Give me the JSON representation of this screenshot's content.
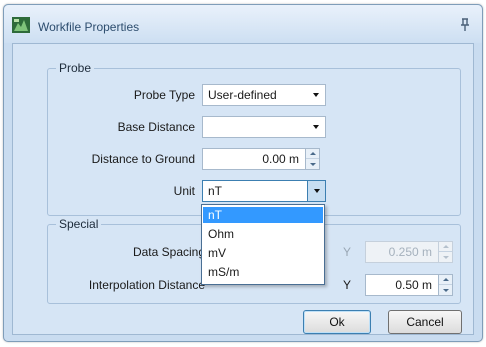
{
  "window": {
    "title": "Workfile Properties",
    "app_icon": "workfile-app-icon",
    "pin_icon": "pin-icon"
  },
  "probe": {
    "group_label": "Probe",
    "probe_type": {
      "label": "Probe Type",
      "value": "User-defined"
    },
    "base_distance": {
      "label": "Base Distance",
      "value": ""
    },
    "distance_to_ground": {
      "label": "Distance to Ground",
      "value": "0.00 m"
    },
    "unit": {
      "label": "Unit",
      "value": "nT"
    }
  },
  "unit_dropdown": {
    "options": [
      "nT",
      "Ohm",
      "mV",
      "mS/m"
    ],
    "selected_index": 0
  },
  "special": {
    "group_label": "Special",
    "data_spacing": {
      "label": "Data Spacing",
      "y_label": "Y",
      "y_value": "0.250 m"
    },
    "interpolation_distance": {
      "label": "Interpolation Distance",
      "y_label": "Y",
      "y_value": "0.50 m"
    }
  },
  "buttons": {
    "ok": "Ok",
    "cancel": "Cancel"
  },
  "colors": {
    "dialog_background": "#d6e5f5",
    "selection": "#3399ff",
    "title_text": "#2d4d6e"
  }
}
